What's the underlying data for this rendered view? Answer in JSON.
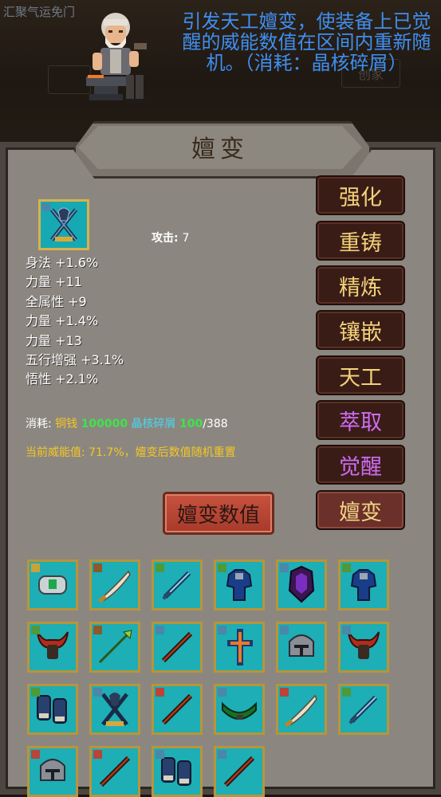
{
  "scene": {
    "caption": "汇聚气运免门",
    "ghost_buttons": [
      "创家"
    ],
    "npc_description": "引发天工嬗变，使装备上已觉醒的威能数值在区间内重新随机。（消耗：晶核碎屑）"
  },
  "panel": {
    "title": "嬗变"
  },
  "item": {
    "icon": "crossed-blades-amulet",
    "attack_label": "攻击:",
    "attack_value": "7",
    "stats": [
      "身法 +1.6%",
      "力量 +11",
      "全属性 +9",
      "力量 +1.4%",
      "力量 +13",
      "五行增强 +3.1%",
      "悟性 +2.1%"
    ]
  },
  "cost": {
    "label": "消耗:",
    "currency1_name": "铜钱",
    "currency1_amount": "100000",
    "currency2_name": "晶核碎屑",
    "currency2_have": "100",
    "currency2_need": "/388"
  },
  "note": "当前威能值: 71.7%，嬗变后数值随机重置",
  "action_button": "嬗变数值",
  "side_tabs": [
    {
      "label": "强化",
      "style": "normal"
    },
    {
      "label": "重铸",
      "style": "normal"
    },
    {
      "label": "精炼",
      "style": "normal"
    },
    {
      "label": "镶嵌",
      "style": "normal"
    },
    {
      "label": "天工",
      "style": "normal"
    },
    {
      "label": "萃取",
      "style": "purple"
    },
    {
      "label": "觉醒",
      "style": "purple"
    },
    {
      "label": "嬗变",
      "style": "active"
    }
  ],
  "inventory": [
    {
      "icon": "bracer-icon",
      "tag": "#c8a23a"
    },
    {
      "icon": "saber-icon",
      "tag": "#8a5a2a"
    },
    {
      "icon": "sword-icon",
      "tag": "#4c9a3c"
    },
    {
      "icon": "armor-icon",
      "tag": "#4c9a3c"
    },
    {
      "icon": "dark-armor-icon",
      "tag": "#4a87a8"
    },
    {
      "icon": "armor-icon",
      "tag": "#4c9a3c"
    },
    {
      "icon": "horned-helm-icon",
      "tag": "#4c9a3c"
    },
    {
      "icon": "spear-icon",
      "tag": "#8a5a2a"
    },
    {
      "icon": "staff-icon",
      "tag": "#4a87a8"
    },
    {
      "icon": "cross-amulet-icon",
      "tag": "#4a87a8"
    },
    {
      "icon": "helmet-icon",
      "tag": "#4a87a8"
    },
    {
      "icon": "horned-helm-icon",
      "tag": "#4a87a8"
    },
    {
      "icon": "gauntlets-icon",
      "tag": "#4c9a3c"
    },
    {
      "icon": "crossed-blades-icon",
      "tag": "#4a87a8"
    },
    {
      "icon": "staff-icon",
      "tag": "#b8443a"
    },
    {
      "icon": "belt-icon",
      "tag": "#4a87a8"
    },
    {
      "icon": "saber-icon",
      "tag": "#b8443a"
    },
    {
      "icon": "sword-icon",
      "tag": "#4c9a3c"
    },
    {
      "icon": "helmet-icon",
      "tag": "#b8443a"
    },
    {
      "icon": "staff-icon",
      "tag": "#b8443a"
    },
    {
      "icon": "gauntlets-icon",
      "tag": "#4a87a8"
    },
    {
      "icon": "staff-icon",
      "tag": "#4a87a8"
    }
  ]
}
